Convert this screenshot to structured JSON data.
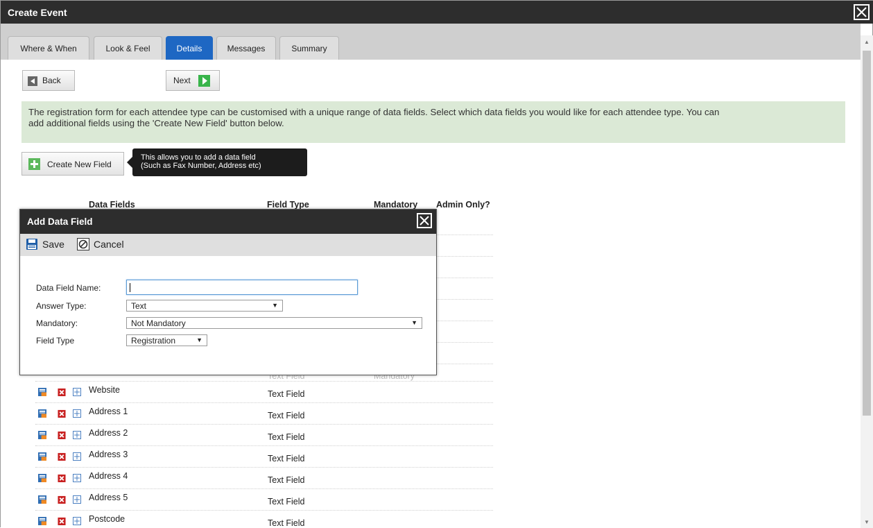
{
  "window": {
    "title": "Create Event"
  },
  "tabs": [
    "Where & When",
    "Look & Feel",
    "Details",
    "Messages",
    "Summary"
  ],
  "active_tab": "Details",
  "nav": {
    "back_label": "Back",
    "next_label": "Next"
  },
  "banner": {
    "line1": "The registration form for each attendee type can be customised with a unique range of data fields. Select which data fields you would like for each attendee type. You can",
    "line2": "add additional fields using the 'Create New Field' button below."
  },
  "create_field": {
    "label": "Create New Field",
    "tooltip_line1": "This allows you to add a data field",
    "tooltip_line2": "(Such as Fax Number, Address etc)"
  },
  "table": {
    "columns": [
      "Data Fields",
      "Field Type",
      "Mandatory",
      "Admin Only?"
    ],
    "partial_row": {
      "type": "Text Field",
      "mandatory": "Mandatory"
    },
    "rows": [
      {
        "name": "Website",
        "type": "Text Field"
      },
      {
        "name": "Address 1",
        "type": "Text Field"
      },
      {
        "name": "Address 2",
        "type": "Text Field"
      },
      {
        "name": "Address 3",
        "type": "Text Field"
      },
      {
        "name": "Address 4",
        "type": "Text Field"
      },
      {
        "name": "Address 5",
        "type": "Text Field"
      },
      {
        "name": "Postcode",
        "type": "Text Field"
      }
    ]
  },
  "modal": {
    "title": "Add Data Field",
    "save_label": "Save",
    "cancel_label": "Cancel",
    "fields": {
      "name_label": "Data Field Name:",
      "name_value": "",
      "answer_type_label": "Answer Type:",
      "answer_type_value": "Text",
      "mandatory_label": "Mandatory:",
      "mandatory_value": "Not Mandatory",
      "field_type_label": "Field Type",
      "field_type_value": "Registration"
    }
  },
  "colors": {
    "titlebar": "#2d2d2d",
    "active_tab": "#1e67c3",
    "banner": "#dbe9d6",
    "next_arrow": "#38b44a",
    "create_plus": "#5cb85c"
  },
  "icons": {
    "window_close": "close-icon",
    "back": "arrow-left-icon",
    "next": "arrow-right-icon",
    "create": "plus-icon",
    "row_edit": "edit-field-icon",
    "row_delete": "delete-icon",
    "row_move": "move-icon",
    "save": "floppy-disk-icon",
    "cancel": "cancel-icon"
  }
}
